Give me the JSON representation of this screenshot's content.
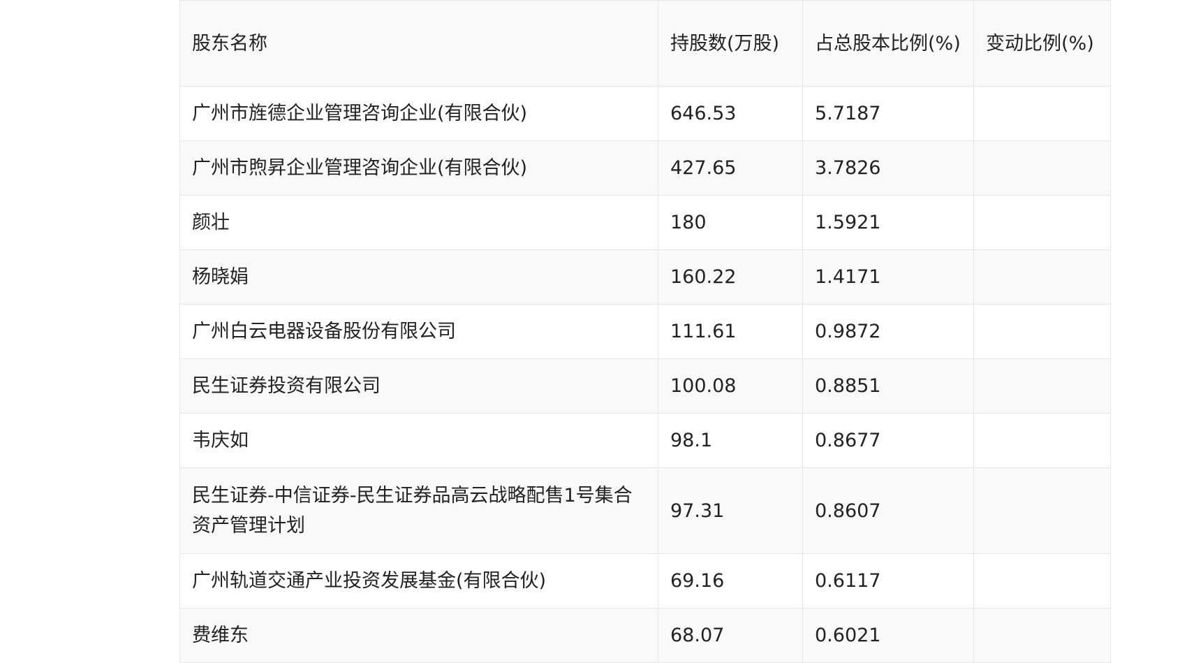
{
  "table": {
    "headers": {
      "name": "股东名称",
      "shares": "持股数(万股)",
      "pct": "占总股本比例(%)",
      "change": "变动比例(%)"
    },
    "rows": [
      {
        "name": "广州市旌德企业管理咨询企业(有限合伙)",
        "shares": "646.53",
        "pct": "5.7187",
        "change": ""
      },
      {
        "name": "广州市煦昇企业管理咨询企业(有限合伙)",
        "shares": "427.65",
        "pct": "3.7826",
        "change": ""
      },
      {
        "name": "颜壮",
        "shares": "180",
        "pct": "1.5921",
        "change": ""
      },
      {
        "name": "杨晓娟",
        "shares": "160.22",
        "pct": "1.4171",
        "change": ""
      },
      {
        "name": "广州白云电器设备股份有限公司",
        "shares": "111.61",
        "pct": "0.9872",
        "change": ""
      },
      {
        "name": "民生证券投资有限公司",
        "shares": "100.08",
        "pct": "0.8851",
        "change": ""
      },
      {
        "name": "韦庆如",
        "shares": "98.1",
        "pct": "0.8677",
        "change": ""
      },
      {
        "name": "民生证券-中信证券-民生证券品高云战略配售1号集合资产管理计划",
        "shares": "97.31",
        "pct": "0.8607",
        "change": ""
      },
      {
        "name": "广州轨道交通产业投资发展基金(有限合伙)",
        "shares": "69.16",
        "pct": "0.6117",
        "change": ""
      },
      {
        "name": "费维东",
        "shares": "68.07",
        "pct": "0.6021",
        "change": ""
      }
    ]
  }
}
